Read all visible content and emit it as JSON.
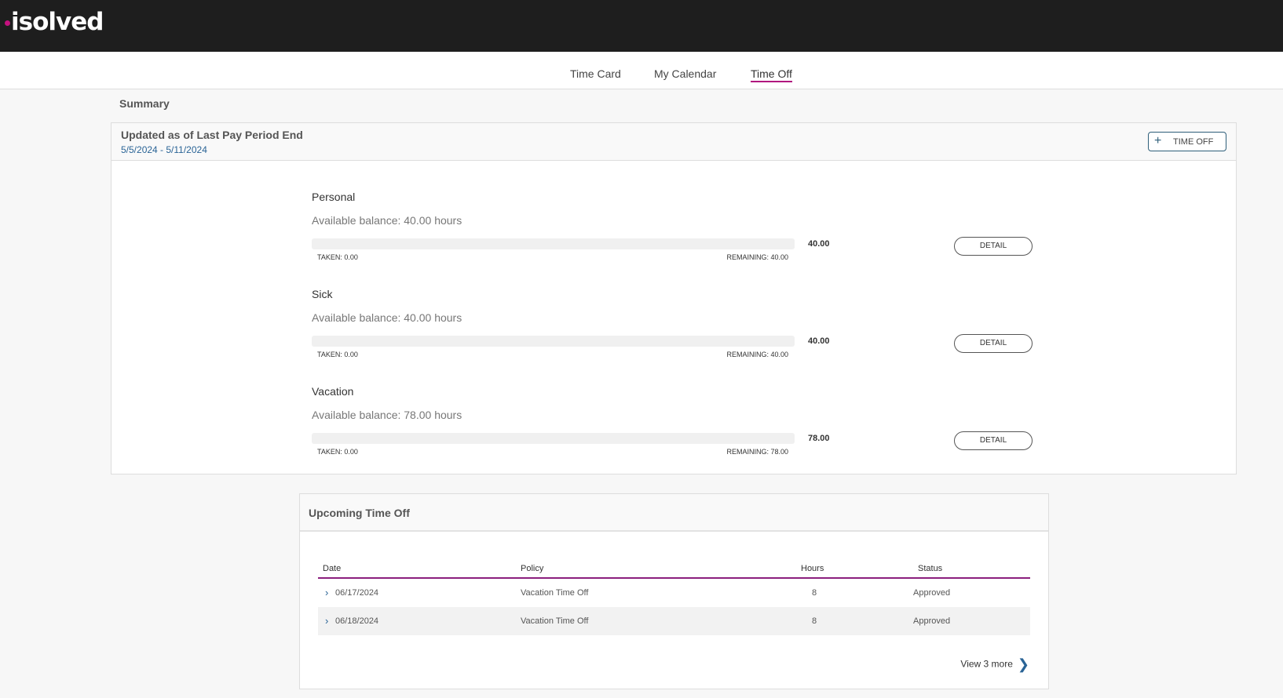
{
  "app": {
    "logo": "isolved"
  },
  "nav": {
    "tabs": [
      {
        "label": "Time Card"
      },
      {
        "label": "My Calendar"
      },
      {
        "label": "Time Off"
      }
    ],
    "active": "Time Off"
  },
  "summary": {
    "title": "Summary",
    "header": "Updated as of Last Pay Period End",
    "date_range": "5/5/2024 - 5/11/2024",
    "add_button": "TIME OFF",
    "policies": [
      {
        "name": "Personal",
        "available": "Available balance: 40.00 hours",
        "value": "40.00",
        "taken": "TAKEN: 0.00",
        "remaining": "REMAINING: 40.00",
        "taken_fraction": 0,
        "detail": "DETAIL"
      },
      {
        "name": "Sick",
        "available": "Available balance: 40.00 hours",
        "value": "40.00",
        "taken": "TAKEN: 0.00",
        "remaining": "REMAINING: 40.00",
        "taken_fraction": 0,
        "detail": "DETAIL"
      },
      {
        "name": "Vacation",
        "available": "Available balance: 78.00 hours",
        "value": "78.00",
        "taken": "TAKEN: 0.00",
        "remaining": "REMAINING: 78.00",
        "taken_fraction": 0,
        "detail": "DETAIL"
      }
    ]
  },
  "upcoming": {
    "title": "Upcoming Time Off",
    "columns": [
      "Date",
      "Policy",
      "Hours",
      "Status"
    ],
    "rows": [
      {
        "date": "06/17/2024",
        "policy": "Vacation Time Off",
        "hours": "8",
        "status": "Approved"
      },
      {
        "date": "06/18/2024",
        "policy": "Vacation Time Off",
        "hours": "8",
        "status": "Approved"
      }
    ],
    "view_more": "View 3 more"
  },
  "colors": {
    "accent": "#b0177f",
    "link": "#2a6496",
    "topbar": "#1e1e1e"
  }
}
